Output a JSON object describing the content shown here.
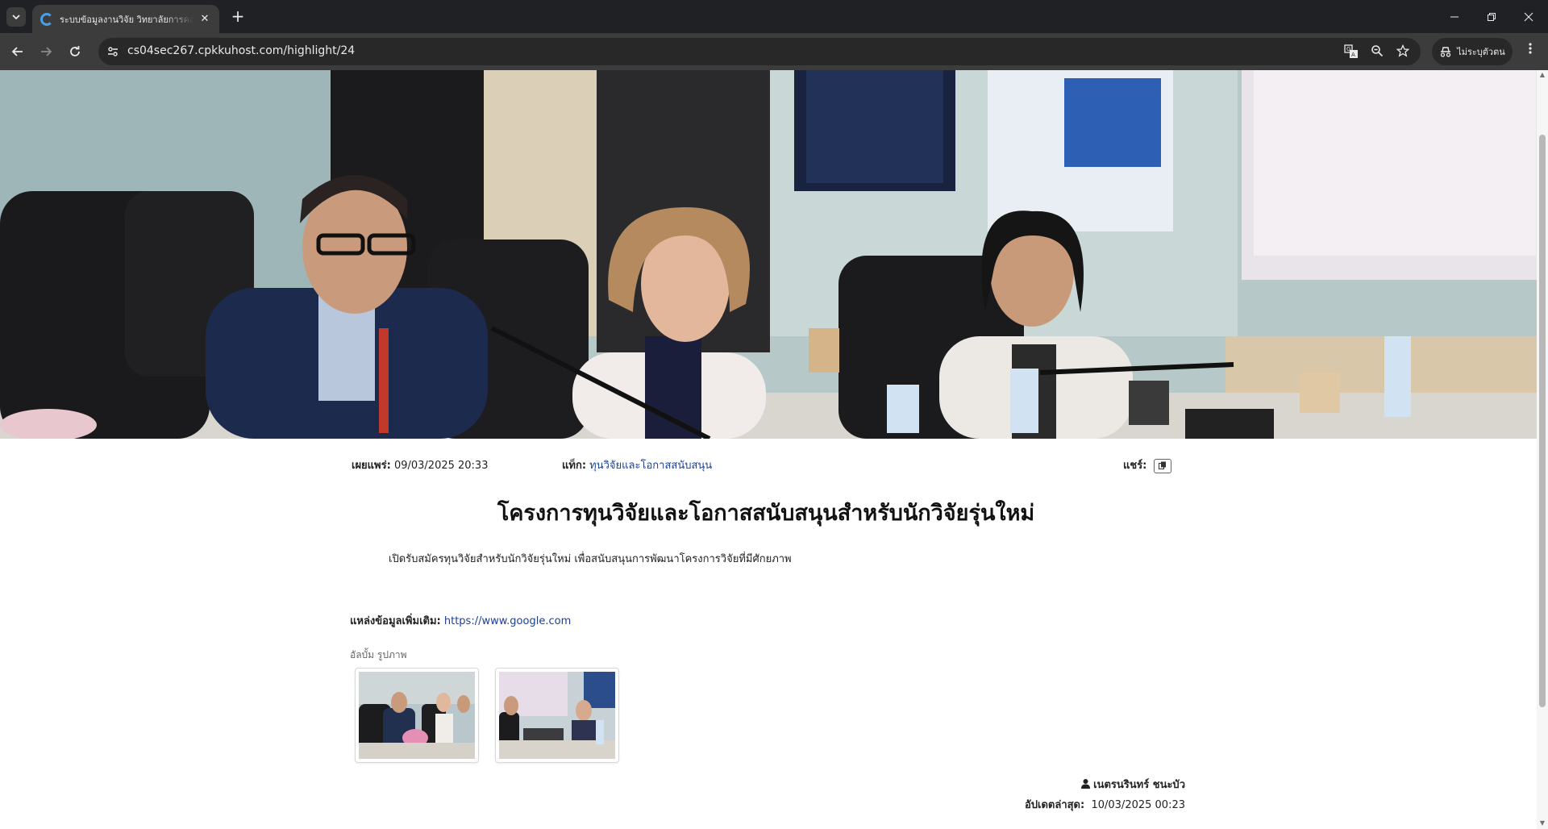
{
  "browser": {
    "tab_title": "ระบบข้อมูลงานวิจัย วิทยาลัยการคอม",
    "url": "cs04sec267.cpkkuhost.com/highlight/24",
    "profile_label": "ไม่ระบุตัวตน",
    "icons": {
      "tab_list": "chevron-down-icon",
      "close_tab": "close-icon",
      "new_tab": "plus-icon",
      "back": "arrow-left-icon",
      "forward": "arrow-right-icon",
      "reload": "reload-icon",
      "site_info": "tune-icon",
      "translate": "translate-icon",
      "zoom": "zoom-icon",
      "bookmark": "star-icon",
      "menu": "kebab-menu-icon"
    }
  },
  "article": {
    "published_label": "เผยแพร่:",
    "published_value": "09/03/2025 20:33",
    "tag_label": "แท็ก:",
    "tag_value": "ทุนวิจัยและโอกาสสนับสนุน",
    "share_label": "แชร์:",
    "title": "โครงการทุนวิจัยและโอกาสสนับสนุนสำหรับนักวิจัยรุ่นใหม่",
    "body": "เปิดรับสมัครทุนวิจัยสำหรับนักวิจัยรุ่นใหม่ เพื่อสนับสนุนการพัฒนาโครงการวิจัยที่มีศักยภาพ",
    "source_label": "แหล่งข้อมูลเพิ่มเติม:",
    "source_link": "https://www.google.com",
    "album_label": "อัลบั้ม รูปภาพ",
    "author": "เนตรนรินทร์ ชนะบัว",
    "updated_label": "อัปเดตล่าสุด:",
    "updated_value": "10/03/2025 00:23"
  },
  "colors": {
    "chrome_dark": "#202124",
    "toolbar": "#3c3c3c",
    "link": "#1c3f94"
  }
}
